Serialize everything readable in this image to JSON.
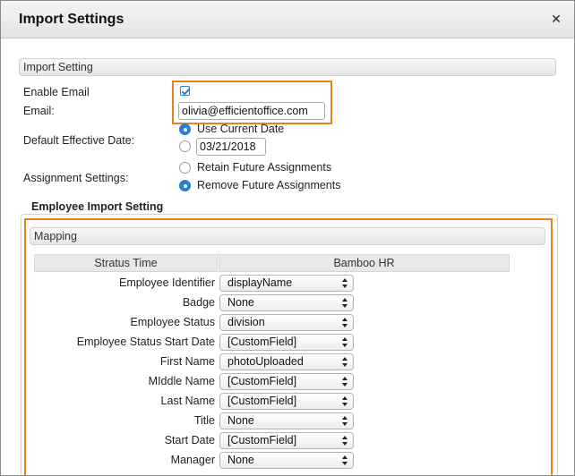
{
  "dialog": {
    "title": "Import Settings",
    "close_glyph": "✕"
  },
  "import_setting": {
    "section_title": "Import Setting",
    "enable_email_label": "Enable Email",
    "enable_email_checked": true,
    "email_label": "Email:",
    "email_value": "olivia@efficientoffice.com",
    "default_date_label": "Default Effective Date:",
    "use_current_date_label": "Use Current Date",
    "date_value": "03/21/2018",
    "assignment_label": "Assignment Settings:",
    "retain_label": "Retain Future Assignments",
    "remove_label": "Remove Future Assignments"
  },
  "employee_import": {
    "legend": "Employee Import Setting",
    "mapping_title": "Mapping",
    "col_left": "Stratus Time",
    "col_right": "Bamboo HR",
    "rows": [
      {
        "label": "Employee Identifier",
        "value": "displayName"
      },
      {
        "label": "Badge",
        "value": "None"
      },
      {
        "label": "Employee Status",
        "value": "division"
      },
      {
        "label": "Employee Status Start Date",
        "value": "[CustomField]"
      },
      {
        "label": "First Name",
        "value": "photoUploaded"
      },
      {
        "label": "MIddle Name",
        "value": "[CustomField]"
      },
      {
        "label": "Last Name",
        "value": "[CustomField]"
      },
      {
        "label": "Title",
        "value": "None"
      },
      {
        "label": "Start Date",
        "value": "[CustomField]"
      },
      {
        "label": "Manager",
        "value": "None"
      }
    ]
  },
  "colors": {
    "highlight": "#e8821e",
    "accent": "#2a7fd4"
  },
  "icons": {
    "close": "close-icon",
    "select_arrows": "chevron-updown-icon",
    "checkbox": "checkmark-icon"
  }
}
